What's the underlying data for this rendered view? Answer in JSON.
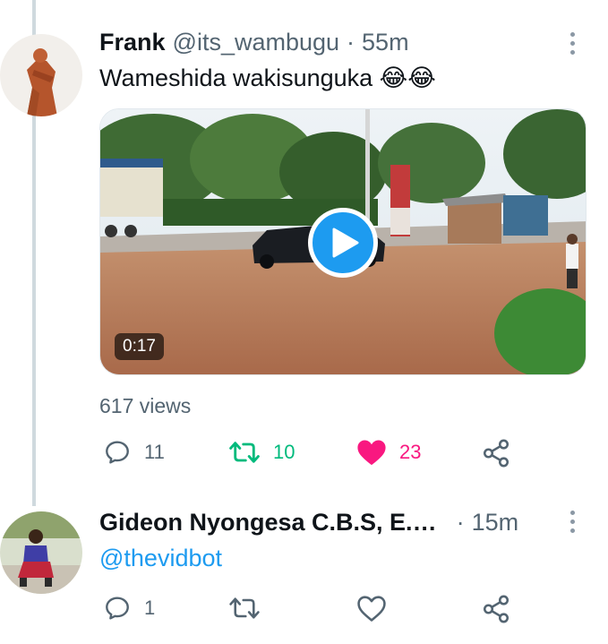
{
  "tweet1": {
    "display_name": "Frank",
    "handle": "@its_wambugu",
    "separator": "·",
    "time": "55m",
    "text": "Wameshida wakisunguka 😂😂",
    "video_duration": "0:17",
    "views": "617 views",
    "replies": "11",
    "retweets": "10",
    "likes": "23",
    "retweeted": true,
    "liked": true
  },
  "tweet2": {
    "display_name": "Gideon Nyongesa C.B.S, E.…",
    "separator": "·",
    "time": "15m",
    "text": "@thevidbot",
    "replies": "1",
    "retweets": "",
    "likes": ""
  },
  "colors": {
    "accent": "#1d9bf0",
    "retweet": "#00ba7c",
    "like": "#f91880",
    "muted": "#536471"
  },
  "icons": [
    "more-icon",
    "play-icon",
    "reply-icon",
    "retweet-icon",
    "heart-icon",
    "share-icon"
  ]
}
